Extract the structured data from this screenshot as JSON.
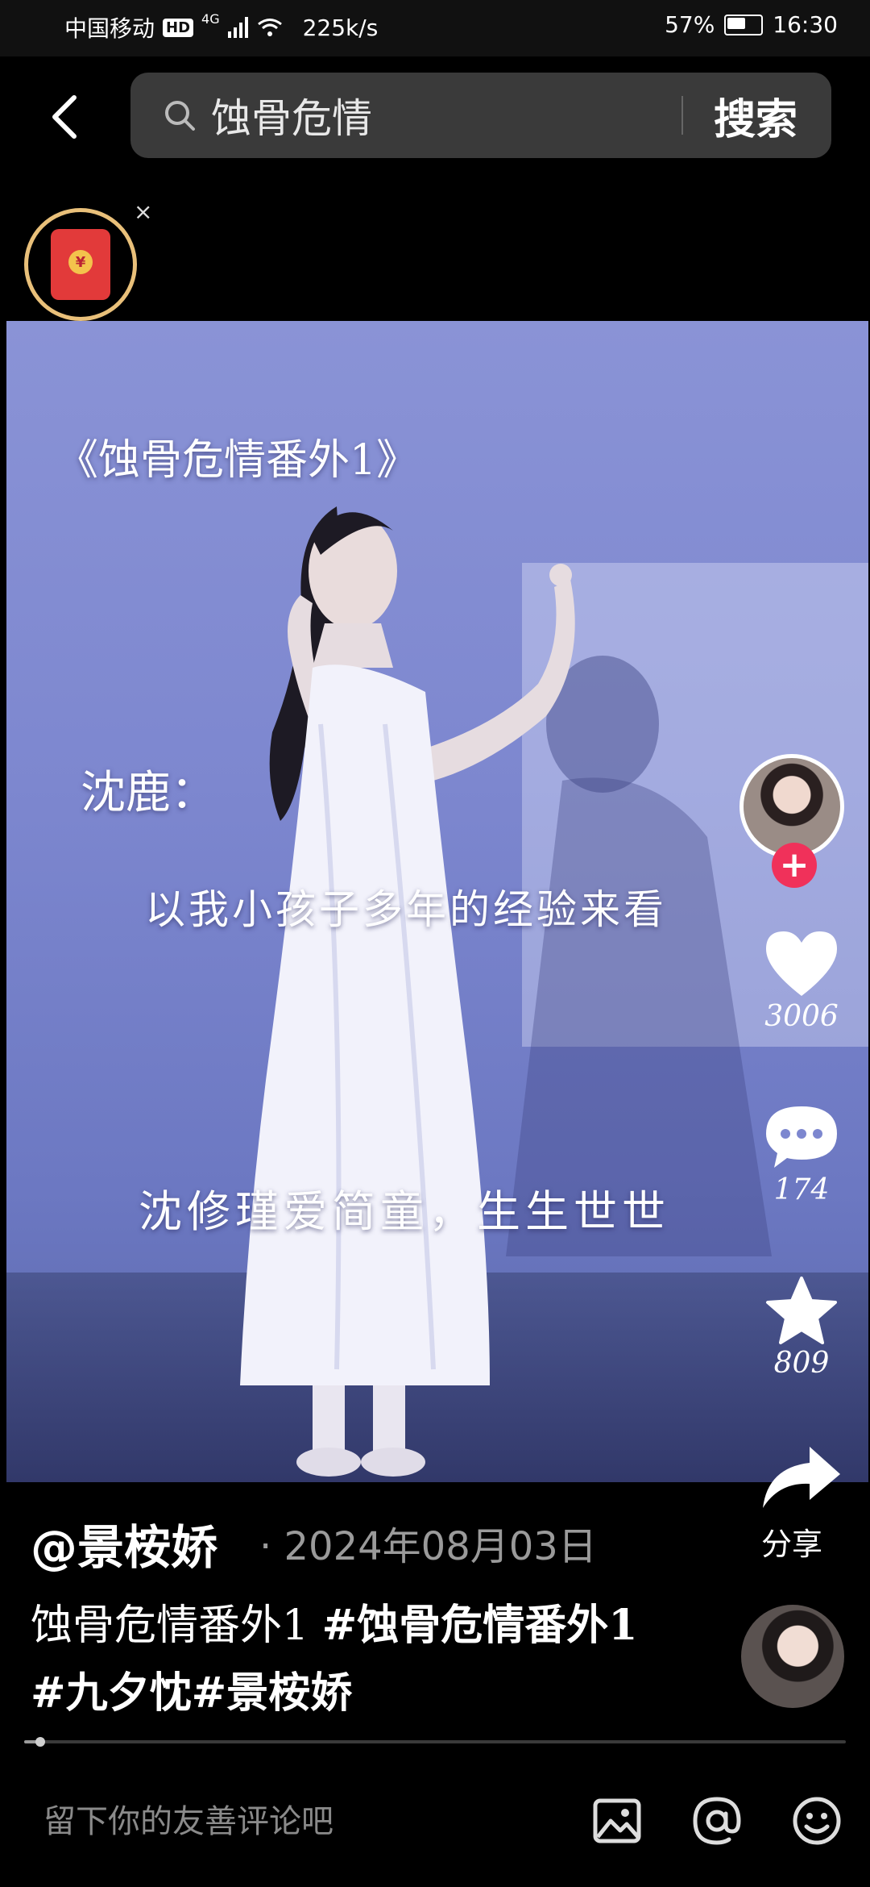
{
  "status_bar": {
    "carrier": "中国移动",
    "hd": "HD",
    "network": "4G",
    "speed": "225k/s",
    "battery": "57%",
    "time": "16:30"
  },
  "search": {
    "query": "蚀骨危情",
    "button_label": "搜索"
  },
  "red_packet": {
    "close": "×",
    "coin": "¥"
  },
  "video_captions": {
    "title": "《蚀骨危情番外1》",
    "speaker": "沈鹿：",
    "line1": "以我小孩子多年的经验来看",
    "line2": "沈修瑾爱简童，生生世世"
  },
  "rail": {
    "follow": "+",
    "likes": "3006",
    "comments": "174",
    "favorites": "809",
    "share_label": "分享"
  },
  "post": {
    "author": "@景桉娇",
    "date": "· 2024年08月03日",
    "desc_plain": "蚀骨危情番外1 ",
    "desc_tags": "#蚀骨危情番外1 #九夕忱#景桉娇"
  },
  "progress": {
    "fraction": 0.02
  },
  "comment_bar": {
    "placeholder": "留下你的友善评论吧"
  },
  "icons": {
    "back": "chevron-left-icon",
    "search": "search-icon",
    "like": "heart-icon",
    "comment": "comment-bubble-icon",
    "favorite": "star-icon",
    "share": "share-arrow-icon",
    "image": "image-icon",
    "mention": "at-icon",
    "emoji": "emoji-icon"
  },
  "colors": {
    "background": "#000000",
    "follow": "#f0315a",
    "red_packet": "#e23a3a",
    "red_packet_ring": "#e9c07a",
    "video_tint": "#7d87cf"
  }
}
